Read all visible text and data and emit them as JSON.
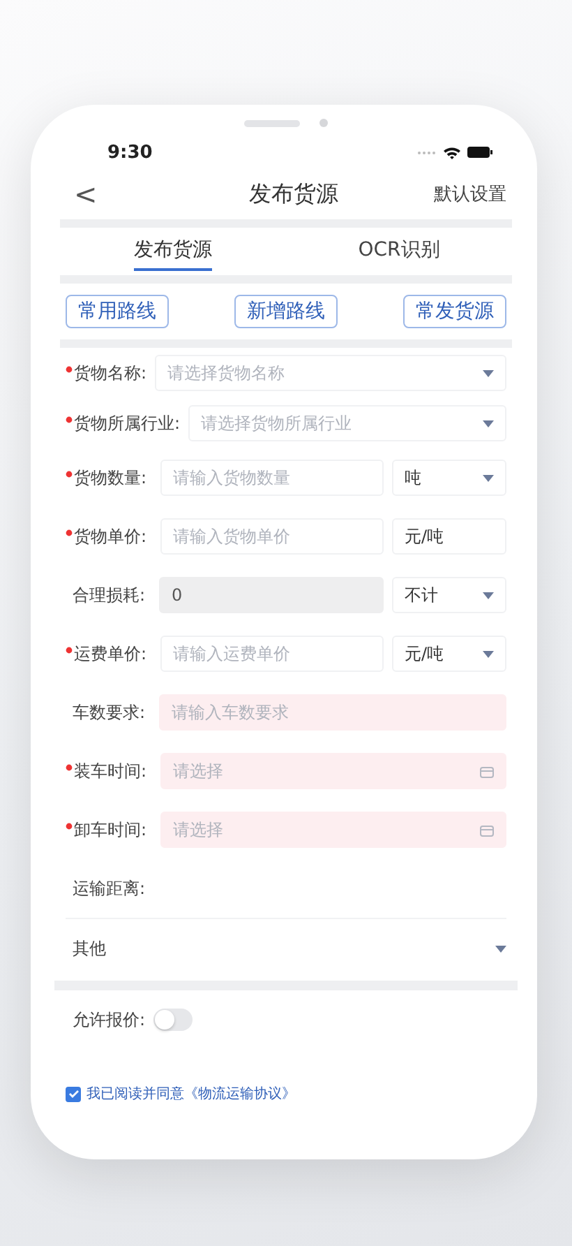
{
  "status_bar": {
    "time": "9:30"
  },
  "nav": {
    "back": "<",
    "title": "发布货源",
    "action": "默认设置"
  },
  "tabs": [
    {
      "label": "发布货源",
      "selected": true
    },
    {
      "label": "OCR识别",
      "selected": false
    }
  ],
  "quick_buttons": [
    "常用路线",
    "新增路线",
    "常发货源"
  ],
  "fields": [
    {
      "kind": "select",
      "label": "货物名称:",
      "required": true,
      "placeholder": "请选择货物名称"
    },
    {
      "kind": "select",
      "label": "货物所属行业:",
      "required": true,
      "placeholder": "请选择货物所属行业"
    },
    {
      "kind": "input_unit",
      "label": "货物数量:",
      "required": true,
      "placeholder": "请输入货物数量",
      "unit": "吨",
      "unit_dropdown": true
    },
    {
      "kind": "input_unit",
      "label": "货物单价:",
      "required": true,
      "placeholder": "请输入货物单价",
      "unit": "元/吨",
      "unit_dropdown": false
    },
    {
      "kind": "input_unit",
      "label": "合理损耗:",
      "required": false,
      "value": "0",
      "disabled": true,
      "unit": "不计",
      "unit_dropdown": true
    },
    {
      "kind": "input_unit",
      "label": "运费单价:",
      "required": true,
      "placeholder": "请输入运费单价",
      "unit": "元/吨",
      "unit_dropdown": true
    },
    {
      "kind": "input",
      "label": "车数要求:",
      "required": false,
      "placeholder": "请输入车数要求",
      "invalid": true
    },
    {
      "kind": "date",
      "label": "装车时间:",
      "required": true,
      "placeholder": "请选择",
      "invalid": true
    },
    {
      "kind": "date",
      "label": "卸车时间:",
      "required": true,
      "placeholder": "请选择",
      "invalid": true
    },
    {
      "kind": "text",
      "label": "运输距离:",
      "required": false
    },
    {
      "kind": "section",
      "label": "其他",
      "required": false
    }
  ],
  "allow_quote": {
    "label": "允许报价:",
    "on": false
  },
  "agreement": {
    "checked": true,
    "text": "我已阅读并同意",
    "link": "《物流运输协议》"
  }
}
